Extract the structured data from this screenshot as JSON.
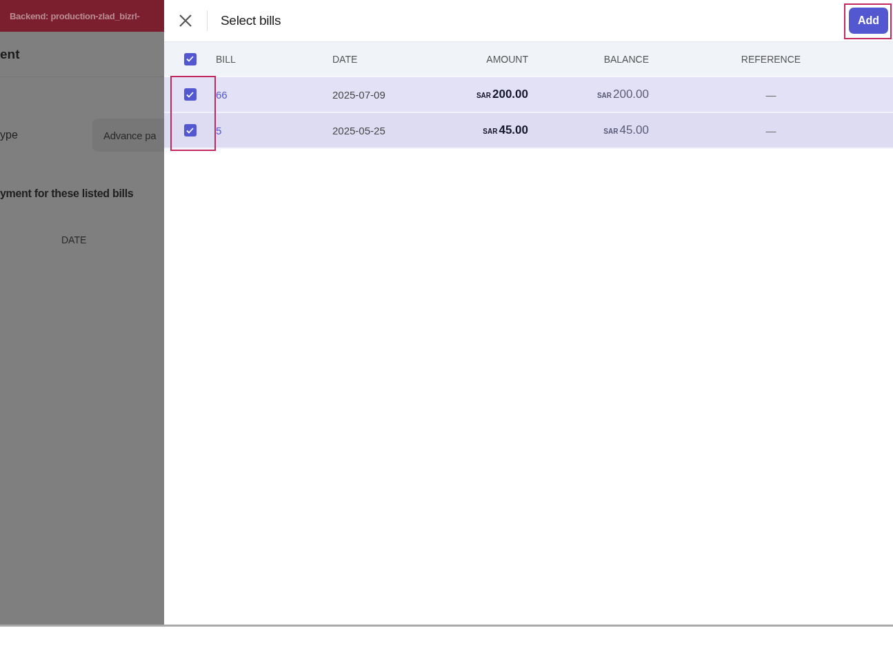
{
  "background_page": {
    "backend_banner": "Backend: production-zlad_bizrl-",
    "heading": "ent",
    "type_label": "ype",
    "type_value": "Advance pa",
    "section_title": "yment for these listed bills",
    "column_header": "DATE"
  },
  "drawer": {
    "title": "Select bills",
    "add_button": "Add",
    "add_highlighted": true,
    "table": {
      "select_all_checked": true,
      "columns": [
        "BILL",
        "DATE",
        "AMOUNT",
        "BALANCE",
        "REFERENCE"
      ],
      "rows": [
        {
          "checked": true,
          "bill": "66",
          "date": "2025-07-09",
          "amount_currency": "SAR",
          "amount": "200.00",
          "balance_currency": "SAR",
          "balance": "200.00",
          "reference": "—"
        },
        {
          "checked": true,
          "bill": "5",
          "date": "2025-05-25",
          "amount_currency": "SAR",
          "amount": "45.00",
          "balance_currency": "SAR",
          "balance": "45.00",
          "reference": "—"
        }
      ],
      "checkbox_highlighted": true
    }
  }
}
